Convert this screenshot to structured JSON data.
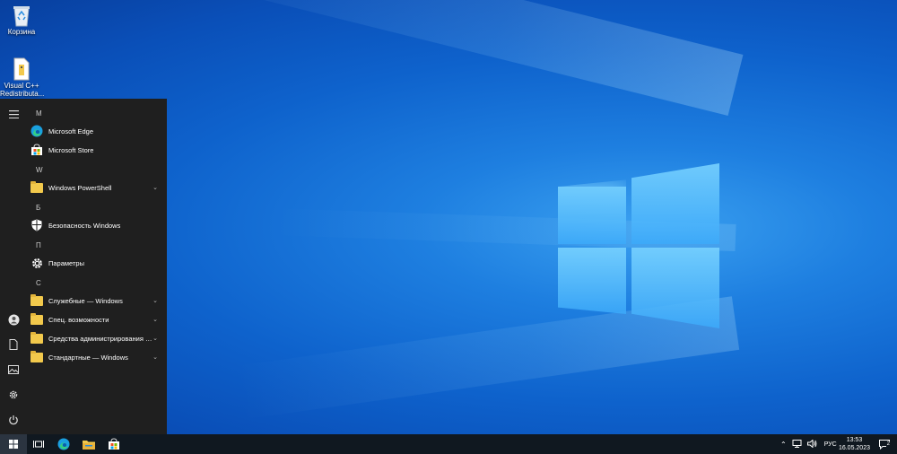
{
  "desktop": {
    "icons": [
      {
        "label": "Корзина",
        "icon": "recycle-bin-icon"
      },
      {
        "label": "Visual C++ Redistributa...",
        "icon": "installer-icon"
      }
    ]
  },
  "start_menu": {
    "rail": [
      "hamburger-menu-icon",
      "user-icon",
      "documents-icon",
      "pictures-icon",
      "settings-icon",
      "power-icon"
    ],
    "groups": [
      {
        "letter": "M",
        "items": [
          {
            "label": "Microsoft Edge",
            "icon": "edge-icon",
            "expandable": false
          },
          {
            "label": "Microsoft Store",
            "icon": "store-icon",
            "expandable": false
          }
        ]
      },
      {
        "letter": "W",
        "items": [
          {
            "label": "Windows PowerShell",
            "icon": "folder-icon",
            "expandable": true
          }
        ]
      },
      {
        "letter": "Б",
        "items": [
          {
            "label": "Безопасность Windows",
            "icon": "shield-icon",
            "expandable": false
          }
        ]
      },
      {
        "letter": "П",
        "items": [
          {
            "label": "Параметры",
            "icon": "gear-icon",
            "expandable": false
          }
        ]
      },
      {
        "letter": "С",
        "items": [
          {
            "label": "Служебные — Windows",
            "icon": "folder-icon",
            "expandable": true
          },
          {
            "label": "Спец. возможности",
            "icon": "folder-icon",
            "expandable": true
          },
          {
            "label": "Средства администрирования W...",
            "icon": "folder-icon",
            "expandable": true
          },
          {
            "label": "Стандартные — Windows",
            "icon": "folder-icon",
            "expandable": true
          }
        ]
      }
    ]
  },
  "taskbar": {
    "pinned": [
      "start-button-icon",
      "task-view-icon",
      "edge-icon",
      "file-explorer-icon",
      "store-icon"
    ],
    "tray": {
      "language": "РУС",
      "time": "13:53",
      "date": "16.05.2023",
      "notifications_count": "2"
    }
  },
  "colors": {
    "accent": "#0078d4",
    "start_bg": "#1f1f1f",
    "taskbar_bg": "#101820",
    "folder": "#f2c94c"
  }
}
